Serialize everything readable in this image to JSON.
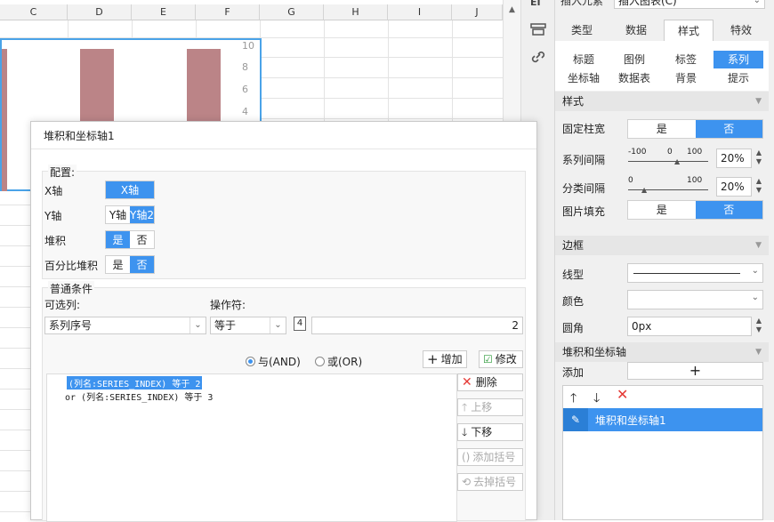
{
  "sheet": {
    "columns": [
      "C",
      "D",
      "E",
      "F",
      "G",
      "H",
      "I",
      "J"
    ],
    "y_ticks": [
      "10",
      "8",
      "6",
      "4"
    ]
  },
  "sidebar": {
    "top_dropdowns": [
      "插入元素",
      "插入图表(C)"
    ],
    "tabs": [
      "类型",
      "数据",
      "样式",
      "特效"
    ],
    "active_tab": "样式",
    "subtabs_row1": [
      "标题",
      "图例",
      "标签",
      "系列"
    ],
    "subtabs_row2": [
      "坐标轴",
      "数据表",
      "背景",
      "提示"
    ],
    "active_subtab": "系列",
    "style_section": "样式",
    "fixed_width_label": "固定柱宽",
    "yes": "是",
    "no": "否",
    "series_gap_label": "系列间隔",
    "series_gap_scale": {
      "min": "-100",
      "mid": "0",
      "max": "100"
    },
    "series_gap_value": "20%",
    "category_gap_label": "分类间隔",
    "category_gap_scale": {
      "min": "0",
      "max": "100"
    },
    "category_gap_value": "20%",
    "image_fill_label": "图片填充",
    "border_section": "边框",
    "line_type_label": "线型",
    "color_label": "颜色",
    "radius_label": "圆角",
    "radius_value": "0px",
    "stack_section": "堆积和坐标轴",
    "add_label": "添加",
    "list_item": "堆积和坐标轴1"
  },
  "dialog": {
    "title": "堆积和坐标轴1",
    "config_legend": "配置:",
    "x_axis_label": "X轴",
    "x_axis_option": "X轴",
    "y_axis_label": "Y轴",
    "y_axis_options": [
      "Y轴",
      "Y轴2"
    ],
    "stack_label": "堆积",
    "percent_label": "百分比堆积",
    "yes": "是",
    "no": "否",
    "cond_legend": "普通条件",
    "col_label": "可选列:",
    "op_label": "操作符:",
    "col_value": "系列序号",
    "op_value": "等于",
    "type_badge": "4",
    "cond_value": "2",
    "and_label": "与(AND)",
    "or_label": "或(OR)",
    "add_btn": "增加",
    "modify_btn": "修改",
    "conditions": [
      "(列名:SERIES_INDEX) 等于 2",
      "or  (列名:SERIES_INDEX) 等于 3"
    ],
    "delete_btn": "删除",
    "up_btn": "上移",
    "down_btn": "下移",
    "add_paren_btn": "添加括号",
    "remove_paren_btn": "去掉括号"
  }
}
